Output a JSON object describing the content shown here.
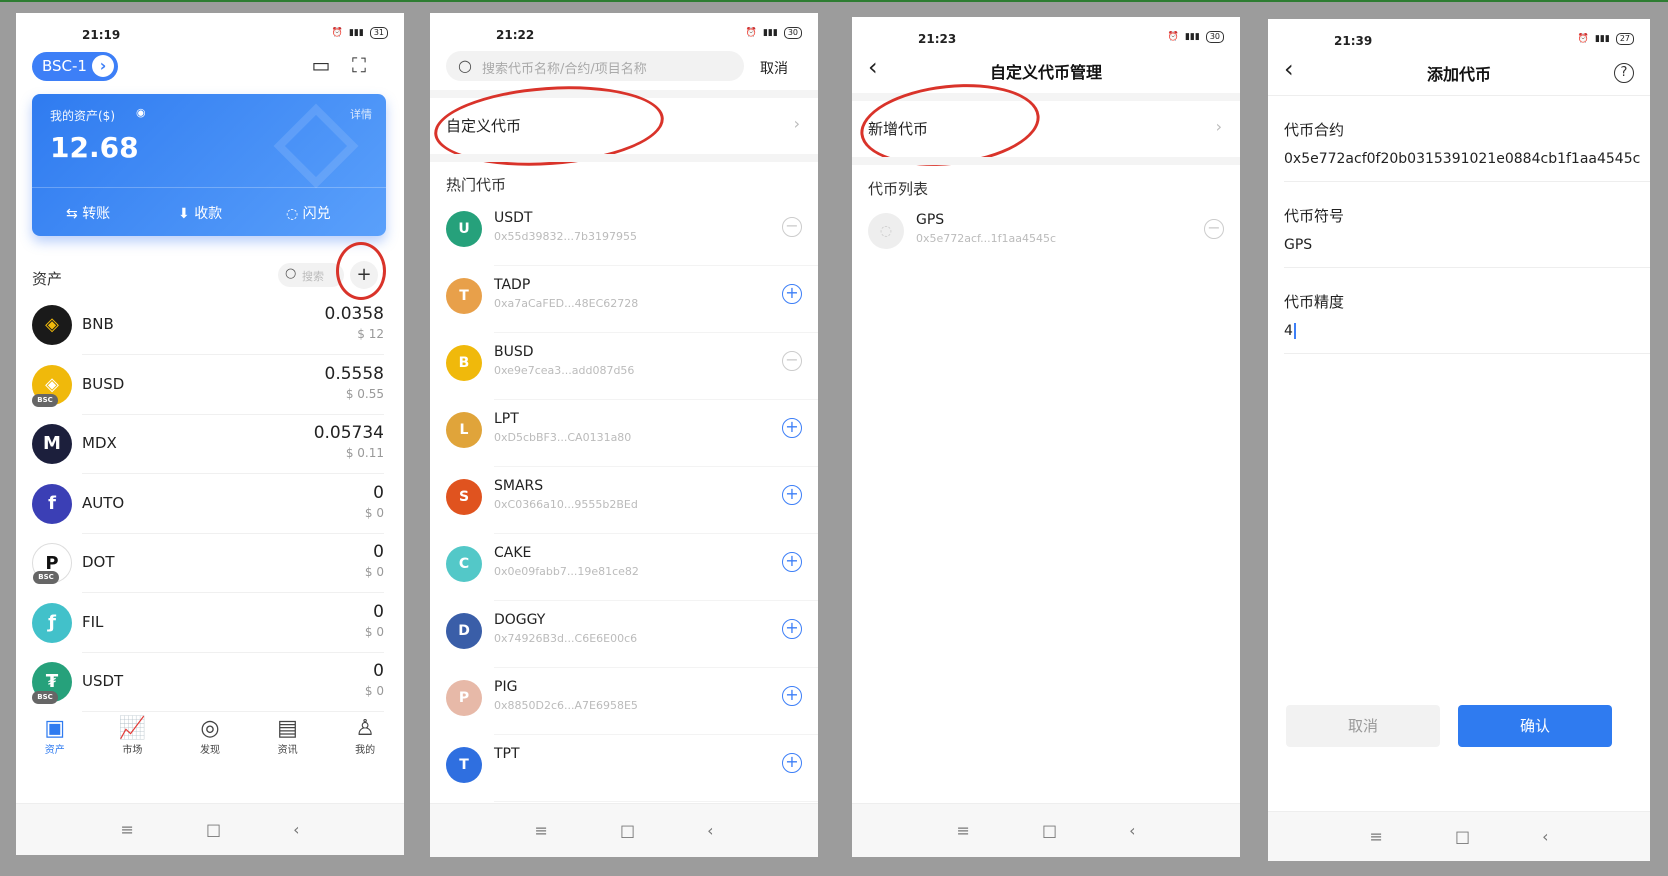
{
  "phones": [
    {
      "status": {
        "time": "21:19",
        "battery": "31"
      },
      "chain_selector": "BSC-1",
      "card": {
        "label": "我的资产($)",
        "detail": "详情",
        "balance": "12.68",
        "actions": [
          "转账",
          "收款",
          "闪兑"
        ]
      },
      "assets_title": "资产",
      "search_placeholder": "搜索",
      "assets": [
        {
          "symbol": "BNB",
          "amount": "0.0358",
          "usd": "$ 12",
          "color": "#1a1a1a",
          "bsc": false
        },
        {
          "symbol": "BUSD",
          "amount": "0.5558",
          "usd": "$ 0.55",
          "color": "#f0b90b",
          "bsc": true
        },
        {
          "symbol": "MDX",
          "amount": "0.05734",
          "usd": "$ 0.11",
          "color": "#1c1f3c",
          "bsc": false
        },
        {
          "symbol": "AUTO",
          "amount": "0",
          "usd": "$ 0",
          "color": "#3b3fb5",
          "bsc": false
        },
        {
          "symbol": "DOT",
          "amount": "0",
          "usd": "$ 0",
          "color": "#ffffff",
          "bsc": true
        },
        {
          "symbol": "FIL",
          "amount": "0",
          "usd": "$ 0",
          "color": "#42c1ca",
          "bsc": false
        },
        {
          "symbol": "USDT",
          "amount": "0",
          "usd": "$ 0",
          "color": "#26a17b",
          "bsc": true
        }
      ],
      "tabs": [
        "资产",
        "市场",
        "发现",
        "资讯",
        "我的"
      ]
    },
    {
      "status": {
        "time": "21:22",
        "battery": "30"
      },
      "search_placeholder": "搜索代币名称/合约/项目名称",
      "cancel": "取消",
      "custom_token": "自定义代币",
      "hot_title": "热门代币",
      "tokens": [
        {
          "symbol": "USDT",
          "address": "0x55d39832...7b3197955",
          "added": true,
          "color": "#26a17b"
        },
        {
          "symbol": "TADP",
          "address": "0xa7aCaFED...48EC62728",
          "added": false,
          "color": "#e8a04a"
        },
        {
          "symbol": "BUSD",
          "address": "0xe9e7cea3...add087d56",
          "added": true,
          "color": "#f0b90b"
        },
        {
          "symbol": "LPT",
          "address": "0xD5cbBF3...CA0131a80",
          "added": false,
          "color": "#e0a43a"
        },
        {
          "symbol": "SMARS",
          "address": "0xC0366a10...9555b2BEd",
          "added": false,
          "color": "#e0531f"
        },
        {
          "symbol": "CAKE",
          "address": "0x0e09fabb7...19e81ce82",
          "added": false,
          "color": "#53c8c8"
        },
        {
          "symbol": "DOGGY",
          "address": "0x74926B3d...C6E6E00c6",
          "added": false,
          "color": "#3a5ea8"
        },
        {
          "symbol": "PIG",
          "address": "0x8850D2c6...A7E6958E5",
          "added": false,
          "color": "#e7b9a8"
        },
        {
          "symbol": "TPT",
          "address": "",
          "added": false,
          "color": "#2f6fe0"
        }
      ]
    },
    {
      "status": {
        "time": "21:23",
        "battery": "30"
      },
      "title": "自定义代币管理",
      "add_token": "新增代币",
      "list_title": "代币列表",
      "tokens": [
        {
          "symbol": "GPS",
          "address": "0x5e772acf...1f1aa4545c"
        }
      ]
    },
    {
      "status": {
        "time": "21:39",
        "battery": "27"
      },
      "title": "添加代币",
      "fields": [
        {
          "label": "代币合约",
          "value": "0x5e772acf0f20b0315391021e0884cb1f1aa4545c"
        },
        {
          "label": "代币符号",
          "value": "GPS"
        },
        {
          "label": "代币精度",
          "value": "4"
        }
      ],
      "cancel": "取消",
      "confirm": "确认"
    }
  ],
  "colors": {
    "accent": "#2f7bf0",
    "annotation": "#d9332a"
  }
}
